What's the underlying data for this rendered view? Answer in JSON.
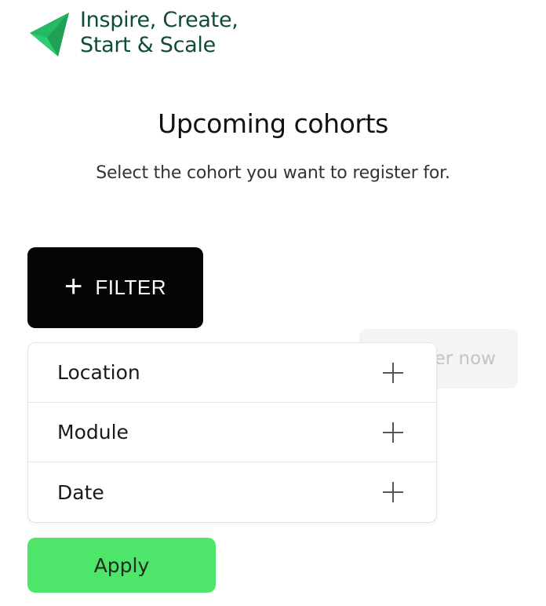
{
  "brand": {
    "line1": "Inspire, Create,",
    "line2": "Start & Scale",
    "logo_icon": "paper-plane-arrow-icon",
    "color": "#0f4c37",
    "accent": "#2ecc71"
  },
  "header": {
    "title": "Upcoming cohorts",
    "subtitle": "Select the cohort you want to register for."
  },
  "filter_button": {
    "icon": "plus-icon",
    "label": "FILTER"
  },
  "register_button": {
    "visible_label": "er now"
  },
  "filters": [
    {
      "label": "Location",
      "icon": "plus-icon"
    },
    {
      "label": "Module",
      "icon": "plus-icon"
    },
    {
      "label": "Date",
      "icon": "plus-icon"
    }
  ],
  "apply_button": {
    "label": "Apply",
    "color": "#4ee56b"
  }
}
